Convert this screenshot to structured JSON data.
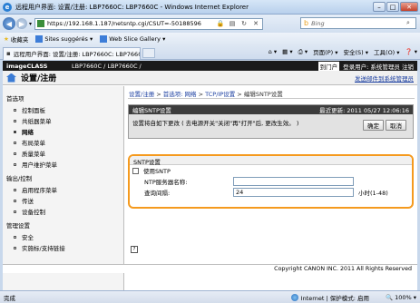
{
  "browser": {
    "title": "远程用户界面: 设置/注册: LBP7660C: LBP7660C - Windows Internet Explorer",
    "url": "https://192.168.1.187/netsntp.cgi/CSUT=-50188596",
    "search_placeholder": "Bing",
    "favorites": "收藏夹",
    "fav_items": [
      "Sites suggérés ▾",
      "Web Slice Gallery ▾"
    ],
    "tab_label": "远程用户界面: 设置/注册: LBP7660C: LBP7660C",
    "cmd_page": "页面(P) ▾",
    "cmd_safety": "安全(S) ▾",
    "cmd_tools": "工具(O) ▾",
    "status": "完成",
    "zone": "Internet | 保护模式: 启用",
    "zoom": "100%"
  },
  "header": {
    "brand": "imageCLASS",
    "model": "LBP7660C / LBP7660C /",
    "top_link": "到门户",
    "user": "登录用户: 系统管理员 注销",
    "app_title": "设置/注册",
    "mail_link": "发送邮件到系统管理员"
  },
  "sidebar": {
    "sections": [
      {
        "label": "首选项",
        "items": [
          "控制面板",
          "共纸器菜单",
          "网络",
          "布局菜单",
          "质量菜单",
          "用户维护菜单"
        ]
      },
      {
        "label": "输出/控制",
        "items": [
          "启用程序菜单",
          "传送",
          "设备控制"
        ]
      },
      {
        "label": "管理设置",
        "items": [
          "安全",
          "实施标/支持链接"
        ]
      }
    ]
  },
  "breadcrumb": {
    "links": [
      "设置/注册",
      "首选项: 网络",
      "TCP/IP设置"
    ],
    "current": "编辑SNTP设置"
  },
  "panel": {
    "title": "编辑SNTP设置",
    "updated": "最近更新: 2011 05/27 12:06:16",
    "message": "设置将自如下更改 ( 去电源开关\"关闭\"再\"打开\"后, 更改生效。 )",
    "ok_label": "确定",
    "cancel_label": "取消"
  },
  "sntp": {
    "heading": "SNTP设置",
    "use_label": "使用SNTP",
    "use_checked": false,
    "server_label": "NTP服务器名称:",
    "server_value": "",
    "interval_label": "查询间隔:",
    "interval_value": "24",
    "interval_unit": "小时(1-48)"
  },
  "footer": {
    "copyright": "Copyright CANON INC. 2011 All Rights Reserved"
  }
}
